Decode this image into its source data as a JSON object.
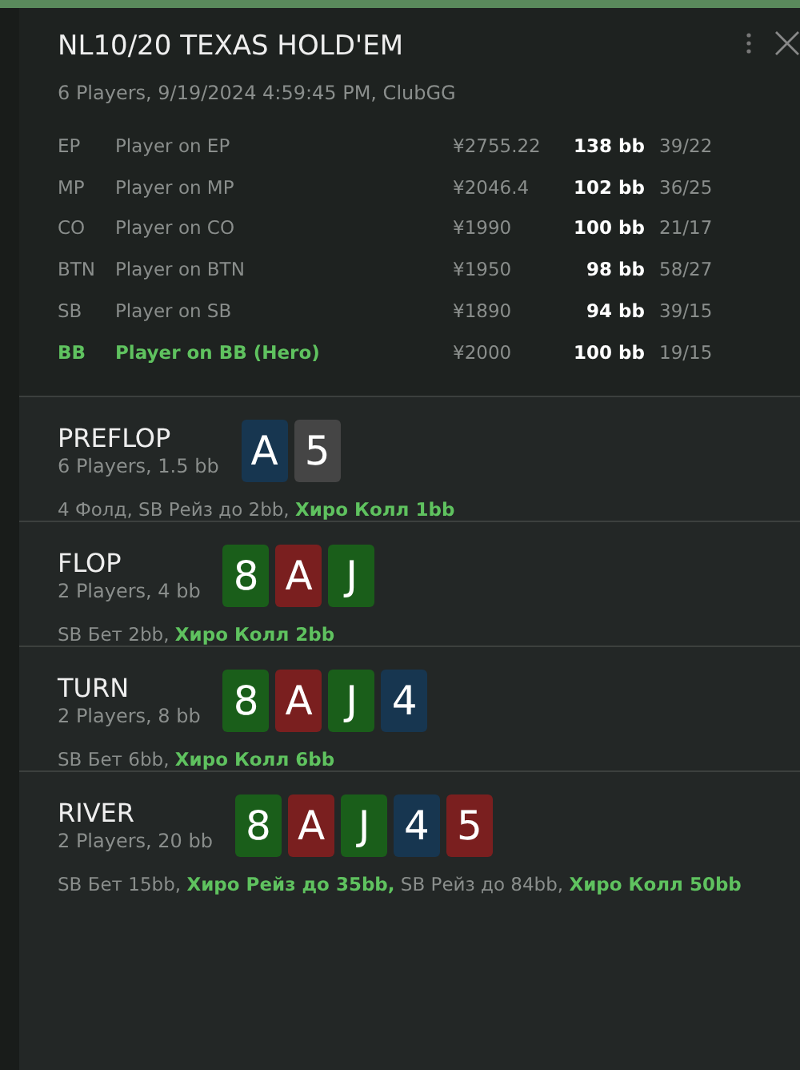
{
  "header": {
    "title": "NL10/20 TEXAS HOLD'EM",
    "subtitle": "6 Players, 9/19/2024 4:59:45 PM, ClubGG"
  },
  "players": [
    {
      "position": "EP",
      "name": "Player on EP",
      "stack": "¥2755.22",
      "bb": "138 bb",
      "stats": "39/22",
      "hero": false
    },
    {
      "position": "MP",
      "name": "Player on MP",
      "stack": "¥2046.4",
      "bb": "102 bb",
      "stats": "36/25",
      "hero": false
    },
    {
      "position": "CO",
      "name": "Player on CO",
      "stack": "¥1990",
      "bb": "100 bb",
      "stats": "21/17",
      "hero": false
    },
    {
      "position": "BTN",
      "name": "Player on BTN",
      "stack": "¥1950",
      "bb": "98 bb",
      "stats": "58/27",
      "hero": false
    },
    {
      "position": "SB",
      "name": "Player on SB",
      "stack": "¥1890",
      "bb": "94 bb",
      "stats": "39/15",
      "hero": false
    },
    {
      "position": "BB",
      "name": "Player on BB (Hero)",
      "stack": "¥2000",
      "bb": "100 bb",
      "stats": "19/15",
      "hero": true
    }
  ],
  "streets": [
    {
      "name": "PREFLOP",
      "info": "6 Players, 1.5 bb",
      "cards": [
        {
          "rank": "A",
          "color": "#173650"
        },
        {
          "rank": "5",
          "color": "#454545"
        }
      ],
      "actions": "4 Фолд, SB Рейз до 2bb, **Хиро Колл 1bb**"
    },
    {
      "name": "FLOP",
      "info": "2 Players, 4 bb",
      "cards": [
        {
          "rank": "8",
          "color": "#1a5e1a"
        },
        {
          "rank": "A",
          "color": "#7a1f1f"
        },
        {
          "rank": "J",
          "color": "#1a5e1a"
        }
      ],
      "actions": "SB Бет 2bb, **Хиро Колл 2bb**"
    },
    {
      "name": "TURN",
      "info": "2 Players, 8 bb",
      "cards": [
        {
          "rank": "8",
          "color": "#1a5e1a"
        },
        {
          "rank": "A",
          "color": "#7a1f1f"
        },
        {
          "rank": "J",
          "color": "#1a5e1a"
        },
        {
          "rank": "4",
          "color": "#173650"
        }
      ],
      "actions": "SB Бет 6bb, **Хиро Колл 6bb**"
    },
    {
      "name": "RIVER",
      "info": "2 Players, 20 bb",
      "cards": [
        {
          "rank": "8",
          "color": "#1a5e1a"
        },
        {
          "rank": "A",
          "color": "#7a1f1f"
        },
        {
          "rank": "J",
          "color": "#1a5e1a"
        },
        {
          "rank": "4",
          "color": "#173650"
        },
        {
          "rank": "5",
          "color": "#7a1f1f"
        }
      ],
      "actions": "SB Бет 15bb, **Хиро Рейз до 35bb,** SB Рейз до 84bb, **Хиро Колл 50bb**"
    }
  ]
}
